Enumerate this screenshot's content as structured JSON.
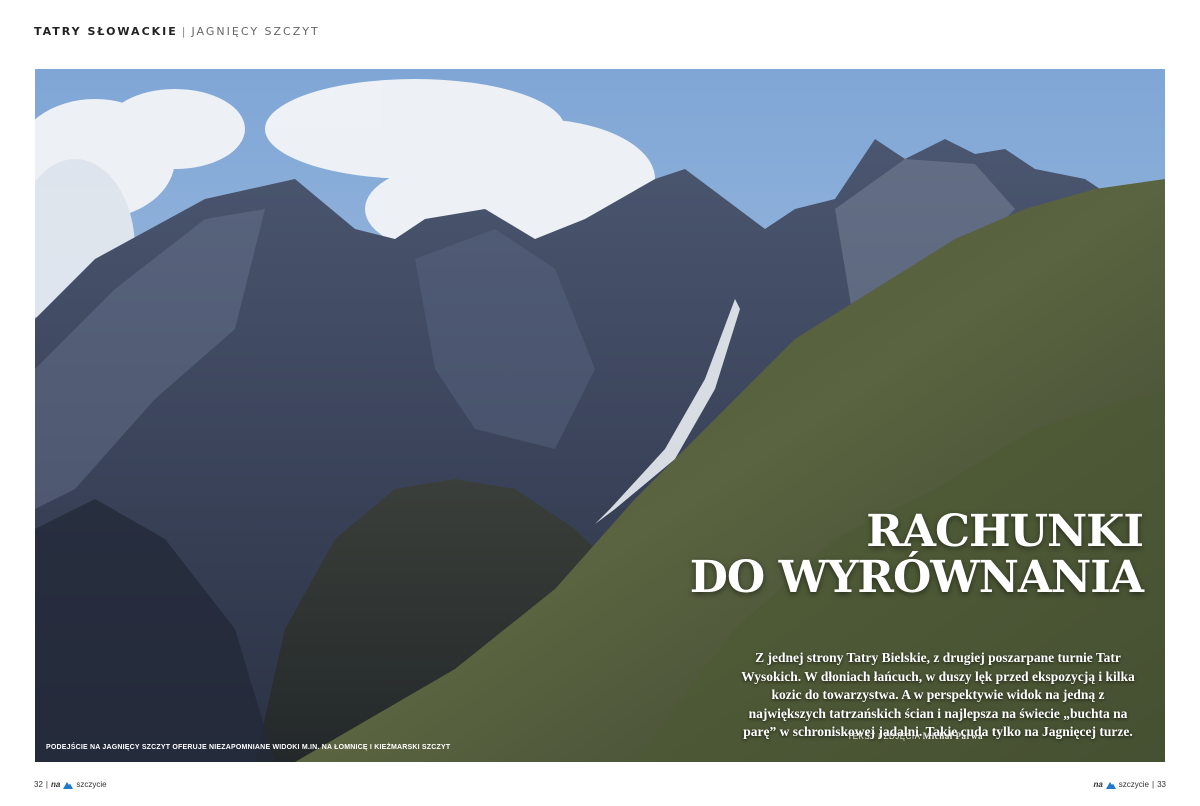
{
  "header": {
    "section": "TATRY SŁOWACKIE",
    "separator": "|",
    "subsection": "JAGNIĘCY SZCZYT"
  },
  "article": {
    "title_line1": "RACHUNKI",
    "title_line2": "DO WYRÓWNANIA",
    "lead": "Z jednej strony Tatry Bielskie, z drugiej poszarpane turnie Tatr Wysokich. W dłoniach łańcuch, w duszy lęk przed ekspozycją i kilka kozic do towarzystwa. A w perspektywie widok na jedną z największych tatrzańskich ścian i najlepsza na świecie „buchta na parę” w schroniskowej jadalni. Takie cuda tylko na Jagnięcej turze.",
    "credit_label": "TEKST I ZDJĘCIA",
    "credit_author": "Michał Parwa"
  },
  "photo": {
    "caption": "PODEJŚCIE NA JAGNIĘCY SZCZYT OFERUJE NIEZAPOMNIANE WIDOKI M.IN. NA ŁOMNICĘ I KIEŻMARSKI SZCZYT"
  },
  "footer": {
    "left_page": "32",
    "right_page": "33",
    "sep": "|",
    "brand_na": "na",
    "brand_name": "szczycie"
  },
  "icons": {
    "brand": "mountain-logo-icon"
  }
}
